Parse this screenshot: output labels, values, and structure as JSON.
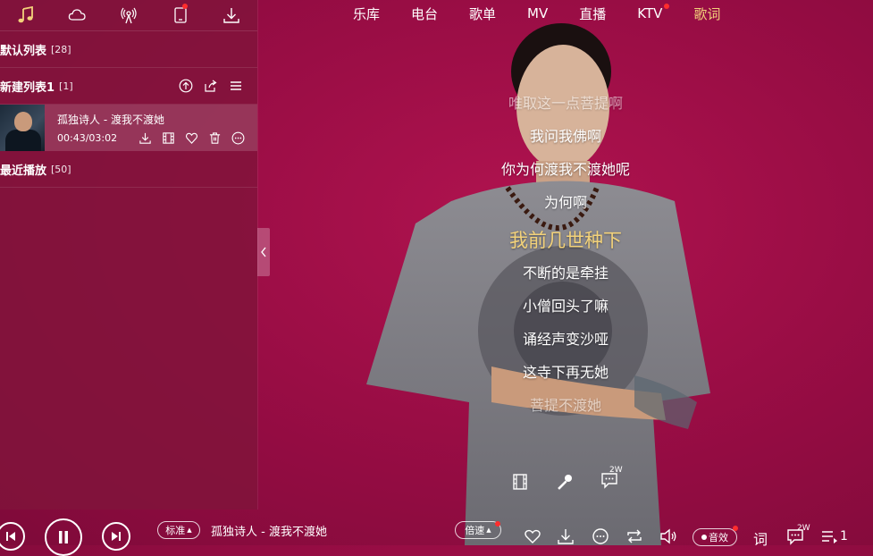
{
  "sidebar": {
    "tabs": [
      {
        "icon": "music-note-icon",
        "active": true
      },
      {
        "icon": "cloud-icon"
      },
      {
        "icon": "radio-antenna-icon"
      },
      {
        "icon": "device-icon",
        "has_dot": true
      },
      {
        "icon": "download-icon"
      }
    ],
    "playlists": {
      "default": {
        "label": "默认列表",
        "count": "[28]"
      },
      "new": {
        "label": "新建列表1",
        "count": "[1]"
      },
      "recent": {
        "label": "最近播放",
        "count": "[50]"
      }
    },
    "song": {
      "title": "孤独诗人 - 渡我不渡她",
      "time": "00:43/03:02"
    }
  },
  "topnav": {
    "items": [
      "乐库",
      "电台",
      "歌单",
      "MV",
      "直播",
      "KTV",
      "歌词"
    ],
    "active": "歌词",
    "dot_on": "KTV"
  },
  "lyrics": {
    "lines": [
      "唯取这一点菩提啊",
      "我问我佛啊",
      "你为何渡我不渡她呢",
      "为何啊",
      "我前几世种下",
      "不断的是牵挂",
      "小僧回头了嘛",
      "诵经声变沙哑",
      "这寺下再无她",
      "菩提不渡她"
    ],
    "current_index": 4,
    "comment_count": "2W"
  },
  "player": {
    "quality_label": "标准",
    "now_playing": "孤独诗人 - 渡我不渡她",
    "speed_label": "倍速",
    "effect_label": "音效",
    "lyric_btn": "词",
    "comment_count": "2W",
    "queue_count": "1"
  },
  "colors": {
    "accent": "#f3d27a",
    "background": "#9a0d45",
    "dot": "#ff2d2d"
  }
}
